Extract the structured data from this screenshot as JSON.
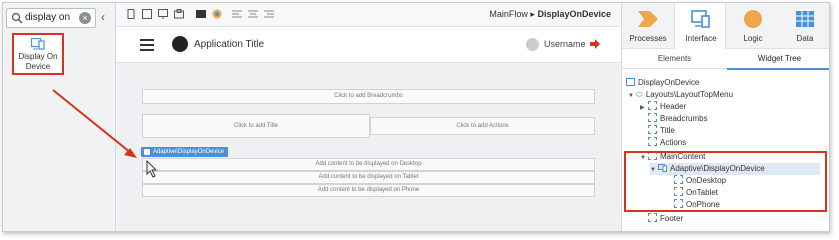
{
  "toolbox": {
    "search_value": "display on",
    "item_label": "Display On Device"
  },
  "toolbar": {
    "flow": "MainFlow",
    "separator": "▸",
    "screen": "DisplayOnDevice"
  },
  "canvas": {
    "app_title": "Application Title",
    "username": "Username",
    "breadcrumbs_hint": "Click to add Breadcrumbs",
    "title_hint": "Click to add Title",
    "actions_hint": "Click to add Actions",
    "adaptive_label": "Adaptive\\DisplayOnDevice",
    "desktop_hint": "Add content to be displayed on Desktop",
    "tablet_hint": "Add content to be displayed on Tablet",
    "phone_hint": "Add content to be displayed on Phone"
  },
  "panel": {
    "tabs": [
      {
        "label": "Processes",
        "color": "#f0a64a"
      },
      {
        "label": "Interface",
        "color": "#4a90d9"
      },
      {
        "label": "Logic",
        "color": "#f0a64a"
      },
      {
        "label": "Data",
        "color": "#4a90d9"
      }
    ],
    "subtabs": [
      "Elements",
      "Widget Tree"
    ],
    "tree": [
      "DisplayOnDevice",
      "Layouts\\LayoutTopMenu",
      "Header",
      "Breadcrumbs",
      "Title",
      "Actions",
      "MainContent",
      "Adaptive\\DisplayOnDevice",
      "OnDesktop",
      "OnTablet",
      "OnPhone",
      "Footer"
    ]
  },
  "colors": {
    "accent": "#4a90d9",
    "highlight": "#d4351c"
  }
}
